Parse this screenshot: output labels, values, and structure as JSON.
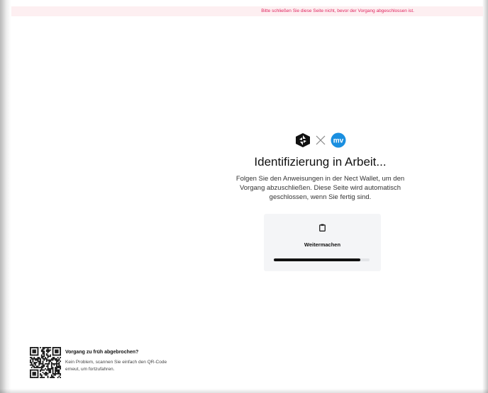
{
  "banner": {
    "text": "Bitte schließen Sie diese Seite nicht, bevor der Vorgang abgeschlossen ist.",
    "color": "#e0245e",
    "background": "#fdeff1"
  },
  "main": {
    "logos": [
      "nect-logo-icon",
      "cross-icon",
      "mv-logo-icon"
    ],
    "mv_logo_text": "mv",
    "mv_color": "#1a8fe0",
    "title": "Identifizierung in Arbeit...",
    "description": "Folgen Sie den Anweisungen in der Nect Wallet, um den Vorgang abzuschließen. Diese Seite wird automatisch geschlossen, wenn Sie fertig sind."
  },
  "card": {
    "icon": "clipboard-icon",
    "label": "Weitermachen",
    "progress_fraction": 0.9
  },
  "help": {
    "qr_icon": "qr-code-icon",
    "title": "Vorgang zu früh abgebrochen?",
    "text": "Kein Problem, scannen Sie einfach den QR-Code erneut, um fortzufahren."
  }
}
